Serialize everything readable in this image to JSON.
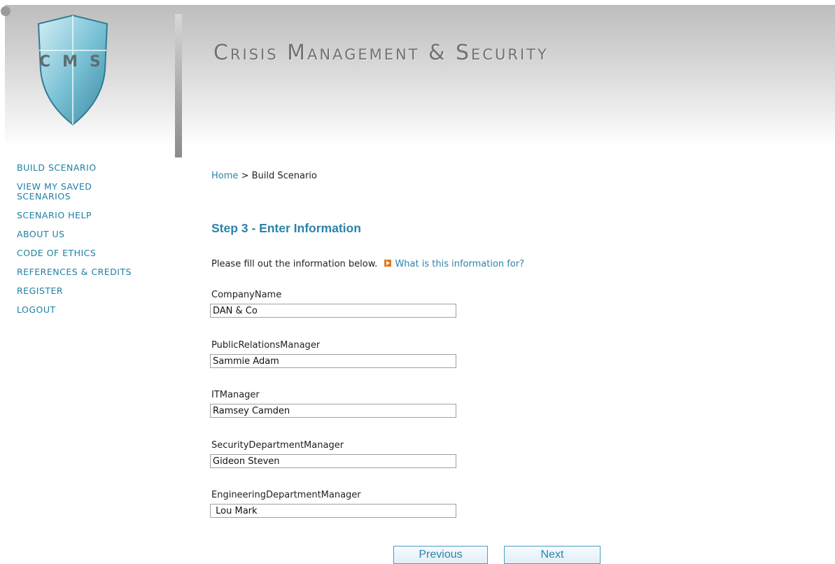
{
  "header": {
    "logo_letters": "CMS",
    "site_title": "Crisis Management & Security"
  },
  "sidebar": {
    "items": [
      {
        "label": "BUILD SCENARIO"
      },
      {
        "label": "VIEW MY SAVED SCENARIOS"
      },
      {
        "label": "SCENARIO HELP"
      },
      {
        "label": "ABOUT US"
      },
      {
        "label": "CODE OF ETHICS"
      },
      {
        "label": "REFERENCES & CREDITS"
      },
      {
        "label": "REGISTER"
      },
      {
        "label": "LOGOUT"
      }
    ]
  },
  "breadcrumb": {
    "home": "Home",
    "separator": ">",
    "current": "Build Scenario"
  },
  "step_title": "Step 3 - Enter Information",
  "intro": {
    "text": "Please fill out the information below.",
    "help_link": "What is this information for?"
  },
  "fields": [
    {
      "label": "CompanyName",
      "value": "DAN & Co"
    },
    {
      "label": "PublicRelationsManager",
      "value": "Sammie Adam"
    },
    {
      "label": "ITManager",
      "value": "Ramsey Camden"
    },
    {
      "label": "SecurityDepartmentManager",
      "value": "Gideon Steven"
    },
    {
      "label": "EngineeringDepartmentManager",
      "value": " Lou Mark"
    }
  ],
  "buttons": {
    "previous": "Previous",
    "next": "Next"
  },
  "colors": {
    "accent": "#2b83a9",
    "nav": "#1e7fa3",
    "icon": "#e07a1f"
  }
}
